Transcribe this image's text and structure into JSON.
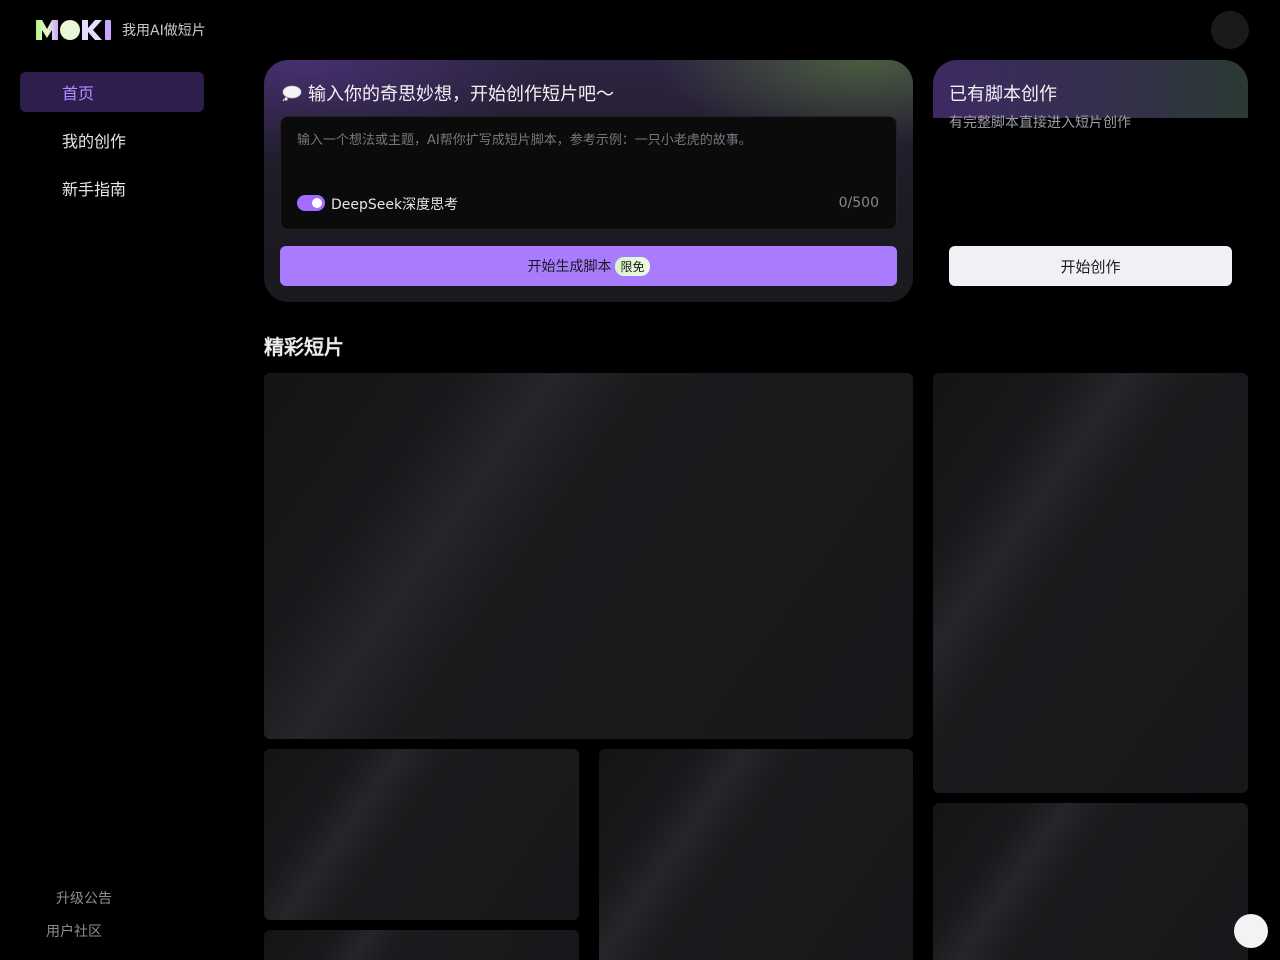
{
  "header": {
    "tagline": "我用AI做短片"
  },
  "sidebar": {
    "items": [
      {
        "label": "首页"
      },
      {
        "label": "我的创作"
      },
      {
        "label": "新手指南"
      }
    ],
    "footer": {
      "upgrade": "升级公告",
      "community": "用户社区"
    }
  },
  "idea_card": {
    "title": "输入你的奇思妙想，开始创作短片吧～",
    "placeholder": "输入一个想法或主题，AI帮你扩写成短片脚本，参考示例：一只小老虎的故事。",
    "value": "",
    "toggle_label": "DeepSeek深度思考",
    "toggle_on": true,
    "char_count": "0/500",
    "button_label": "开始生成脚本",
    "badge": "限免"
  },
  "script_card": {
    "title": "已有脚本创作",
    "subtitle": "有完整脚本直接进入短片创作",
    "button_label": "开始创作"
  },
  "gallery": {
    "title": "精彩短片"
  },
  "colors": {
    "accent": "#a97bff",
    "nav_active_bg": "#2e1e4e",
    "nav_active_text": "#b48cff"
  }
}
